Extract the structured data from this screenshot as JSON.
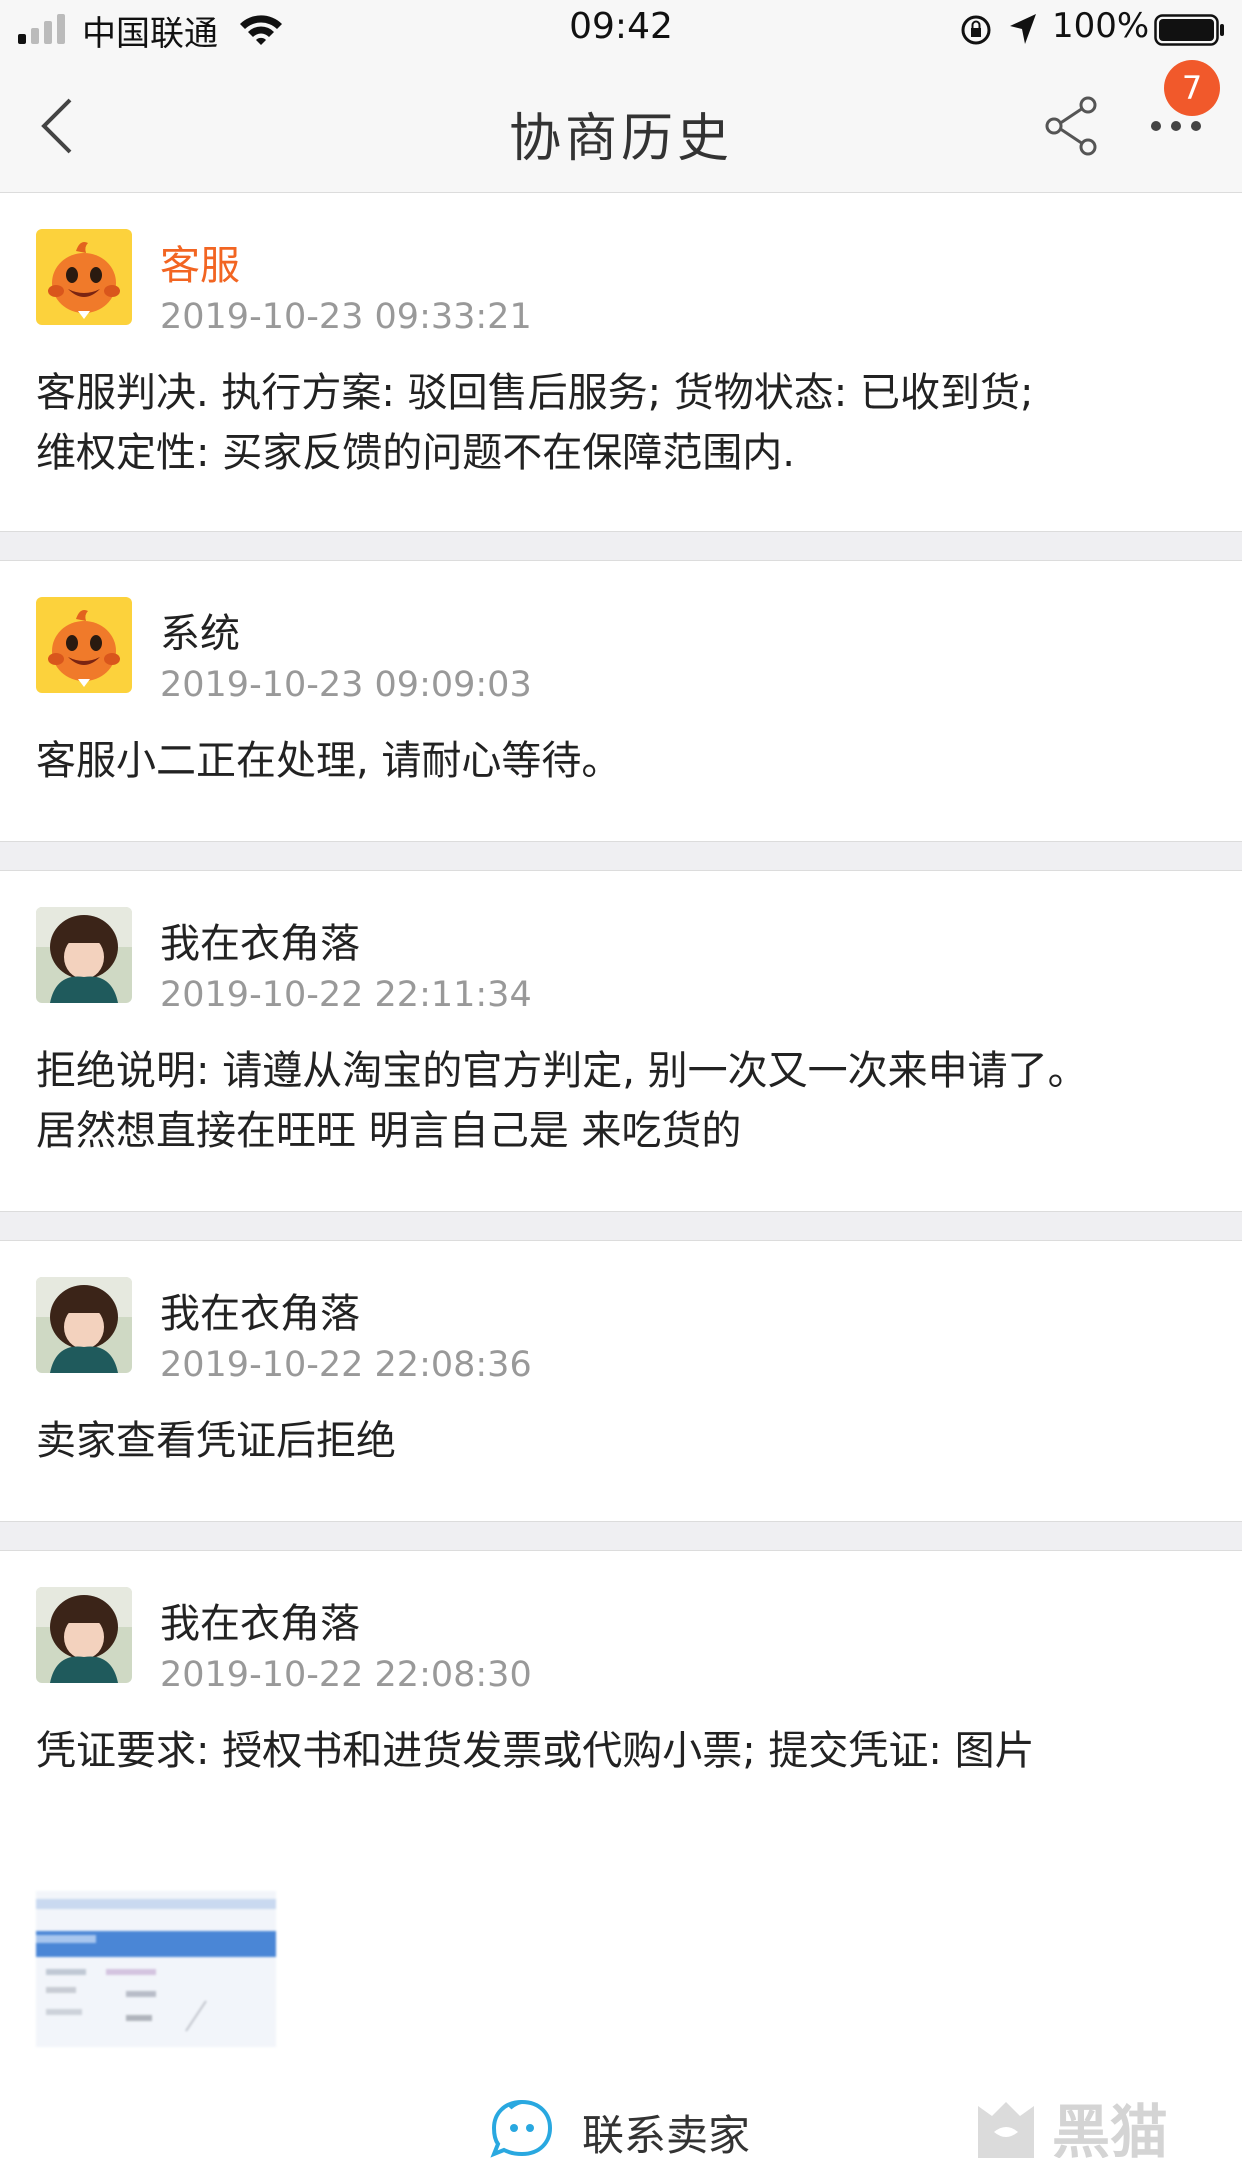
{
  "status_bar": {
    "carrier": "中国联通",
    "time": "09:42",
    "battery": "100%"
  },
  "navbar": {
    "title": "协商历史",
    "badge": "7",
    "icons": [
      "back-icon",
      "share-icon",
      "more-icon"
    ]
  },
  "records": [
    {
      "name": "客服",
      "time": "2019-10-23 09:33:21",
      "lines": [
        "客服判决. 执行方案: 驳回售后服务; 货物状态: 已收到货;",
        "维权定性: 买家反馈的问题不在保障范围内."
      ],
      "avatar": "mascot"
    },
    {
      "name": "系统",
      "time": "2019-10-23 09:09:03",
      "lines": [
        "客服小二正在处理, 请耐心等待。"
      ],
      "avatar": "mascot"
    },
    {
      "name": "我在衣角落",
      "time": "2019-10-22 22:11:34",
      "lines": [
        "拒绝说明: 请遵从淘宝的官方判定, 别一次又一次来申请了。",
        "居然想直接在旺旺 明言自己是 来吃货的"
      ],
      "avatar": "photo"
    },
    {
      "name": "我在衣角落",
      "time": "2019-10-22 22:08:36",
      "lines": [
        "卖家查看凭证后拒绝"
      ],
      "avatar": "photo"
    },
    {
      "name": "我在衣角落",
      "time": "2019-10-22 22:08:30",
      "lines": [
        "凭证要求: 授权书和进货发票或代购小票; 提交凭证: 图片"
      ],
      "avatar": "photo"
    }
  ],
  "bottom": {
    "contact_label": "联系卖家",
    "watermark": "黑猫"
  },
  "colors": {
    "accent_orange": "#f26522",
    "badge": "#f1592b",
    "contact_blue": "#29a8e0"
  }
}
